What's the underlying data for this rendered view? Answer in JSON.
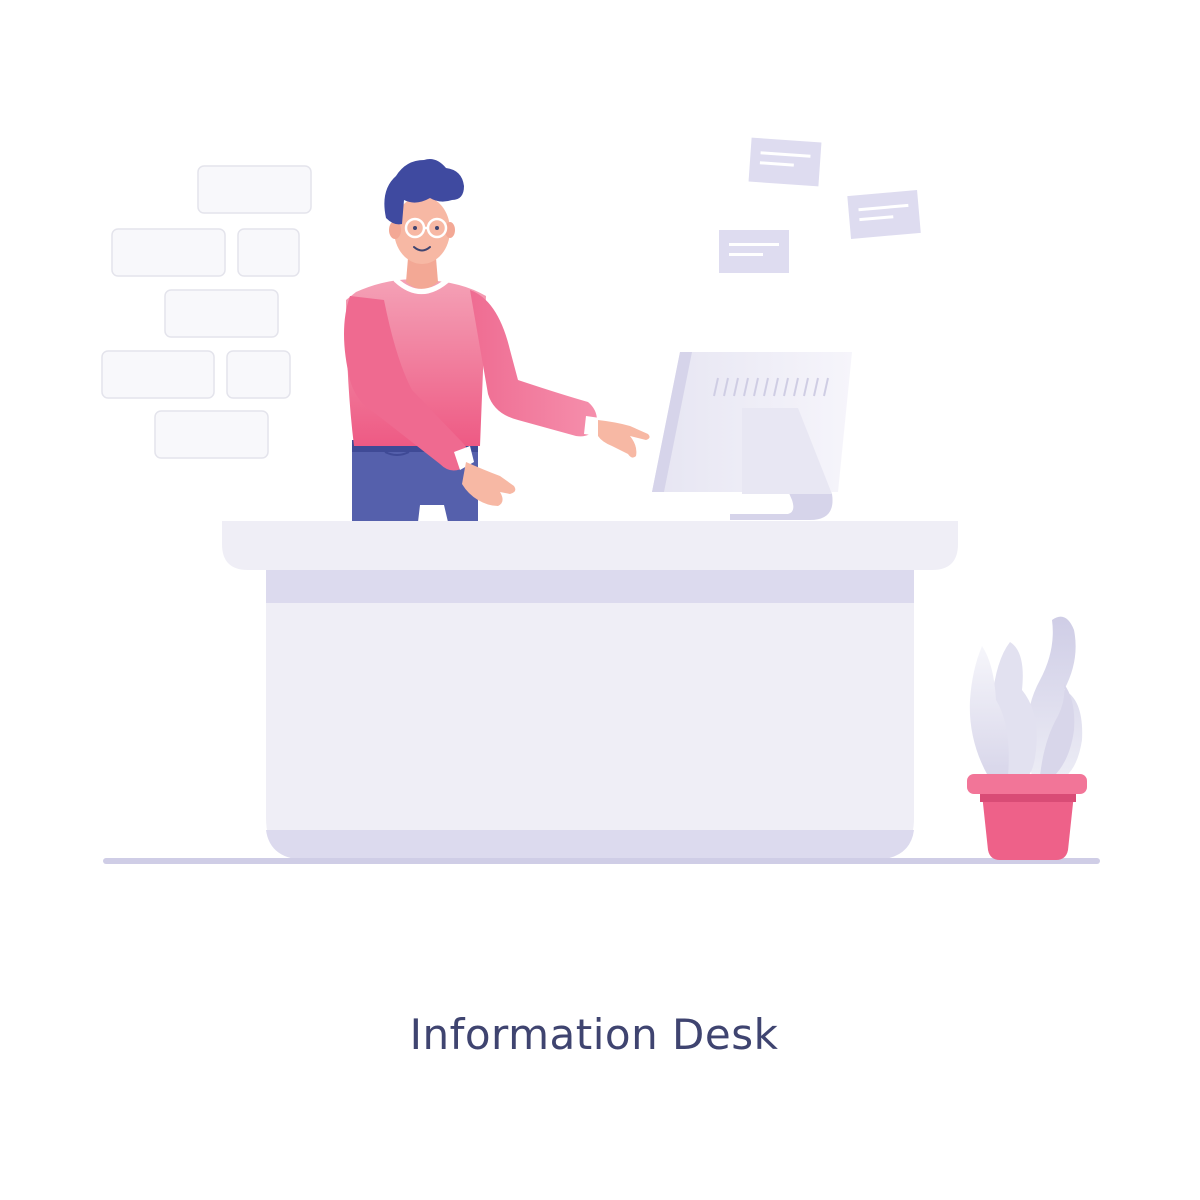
{
  "caption": "Information Desk",
  "colors": {
    "background": "#ffffff",
    "brick": "#f8f8fb",
    "brick_border": "#e6e6ee",
    "note_fill": "#dedcf0",
    "note_lines": "#ffffff",
    "desk_light": "#efeef6",
    "desk_band": "#dcdaee",
    "floor": "#cfcde6",
    "sweater_light": "#f28eaa",
    "sweater_dark": "#ee5e86",
    "jeans": "#5560ac",
    "hair": "#3f4aa0",
    "skin": "#f7b8a4",
    "pot": "#ee6189",
    "pot_rim": "#f27598",
    "leaf_light": "#ececf5",
    "leaf_dark": "#bcbadb",
    "monitor": "#f3f2f9",
    "monitor_edge": "#d6d4ea",
    "caption_text": "#3f4470"
  },
  "icons": {
    "figure": "receptionist-figure",
    "monitor": "monitor-icon",
    "plant": "potted-plant-icon",
    "notes": "message-note-icon",
    "wall": "brick-wall"
  }
}
